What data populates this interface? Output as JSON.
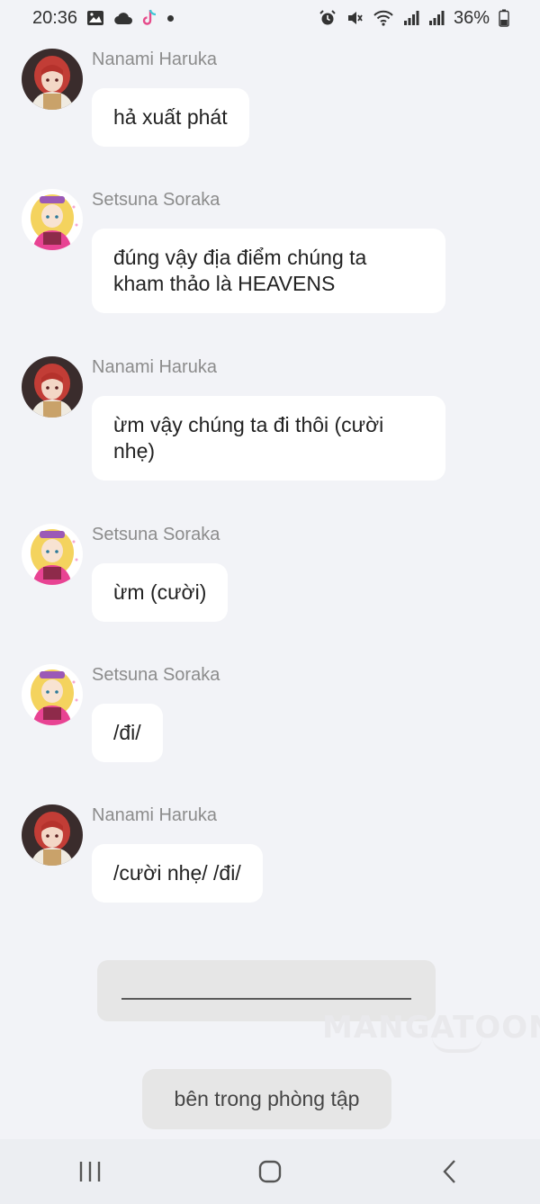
{
  "status_bar": {
    "time": "20:36",
    "battery": "36%",
    "left_icons": [
      "image-icon",
      "cloud-icon",
      "tiktok-icon",
      "dot-icon"
    ],
    "right_icons": [
      "alarm-icon",
      "mute-icon",
      "wifi-icon",
      "signal-icon",
      "signal-icon",
      "battery-icon"
    ]
  },
  "messages": [
    {
      "sender": "Nanami Haruka",
      "text_lines": [
        "hả xuất phát"
      ],
      "avatar": "red-hair-avatar"
    },
    {
      "sender": "Setsuna Soraka",
      "text_lines": [
        "đúng vậy địa điểm chúng ta",
        "kham thảo là HEAVENS"
      ],
      "avatar": "blonde-avatar"
    },
    {
      "sender": "Nanami Haruka",
      "text_lines": [
        "ừm vậy chúng ta đi thôi (cười",
        "nhẹ)"
      ],
      "avatar": "red-hair-avatar"
    },
    {
      "sender": "Setsuna Soraka",
      "text_lines": [
        "ừm (cười)"
      ],
      "avatar": "blonde-avatar"
    },
    {
      "sender": "Setsuna Soraka",
      "text_lines": [
        "/đi/"
      ],
      "avatar": "blonde-avatar"
    },
    {
      "sender": "Nanami Haruka",
      "text_lines": [
        "/cười nhẹ/ /đi/"
      ],
      "avatar": "red-hair-avatar"
    }
  ],
  "input": {
    "value": ""
  },
  "watermark": "MANGATOON",
  "choice": {
    "label": "bên trong phòng tập"
  },
  "nav": {
    "buttons": [
      "recent-apps-icon",
      "home-icon",
      "back-icon"
    ]
  },
  "colors": {
    "background": "#f2f3f7",
    "bubble": "#ffffff",
    "sender": "#8c8c8c"
  }
}
